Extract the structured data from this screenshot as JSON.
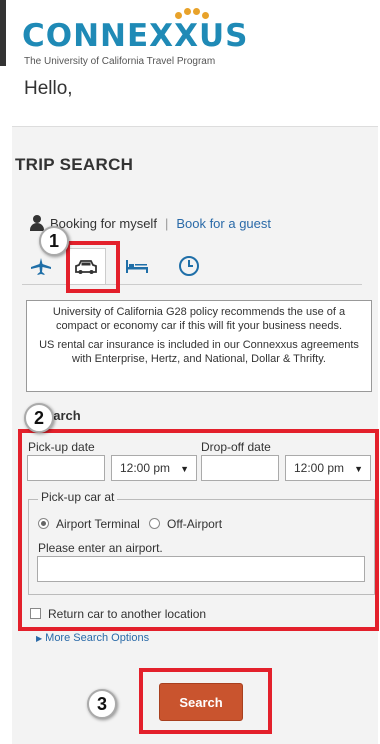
{
  "header": {
    "logo_text": "CONNEXXUS",
    "tagline": "The University of California Travel Program",
    "greeting": "Hello,"
  },
  "trip_search": {
    "title": "TRIP SEARCH",
    "booking_self": "Booking for myself",
    "separator": "|",
    "booking_guest": "Book for a guest",
    "tabs": [
      {
        "name": "flight",
        "icon": "airplane-icon",
        "active": false
      },
      {
        "name": "car",
        "icon": "car-icon",
        "active": true
      },
      {
        "name": "hotel",
        "icon": "bed-icon",
        "active": false
      },
      {
        "name": "history",
        "icon": "clock-icon",
        "active": false
      }
    ]
  },
  "policy": {
    "line1": "University of California G28 policy recommends the use of a compact or economy car if this will fit your business needs.",
    "line2": "US rental car insurance is included in our Connexxus agreements with Enterprise, Hertz, and National, Dollar & Thrifty."
  },
  "car_search": {
    "label": "earch",
    "pickup_date_label": "Pick-up date",
    "pickup_date_value": "",
    "pickup_time": "12:00 pm",
    "dropoff_date_label": "Drop-off date",
    "dropoff_date_value": "",
    "dropoff_time": "12:00 pm",
    "pickup_location_legend": "Pick-up car at",
    "airport_terminal": "Airport Terminal",
    "off_airport": "Off-Airport",
    "airport_prompt": "Please enter an airport.",
    "airport_value": "",
    "return_other": "Return car to another location",
    "more_options": "More Search Options",
    "search_button": "Search"
  },
  "callouts": [
    "1",
    "2",
    "3"
  ],
  "colors": {
    "brand_blue": "#1f8ab6",
    "brand_orange": "#e8a22a",
    "search_button": "#c9542e",
    "callout_red": "#e3202b",
    "link_blue": "#2a6aa8"
  }
}
